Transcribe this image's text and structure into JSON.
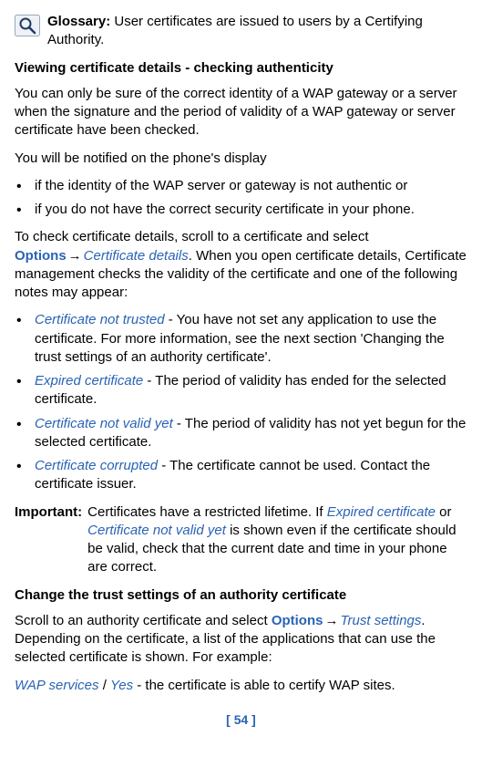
{
  "glossary": {
    "label": "Glossary:",
    "text": "User certificates are issued to users by a Certifying Authority."
  },
  "section1": {
    "heading": "Viewing certificate details - checking authenticity",
    "para1": "You can only be sure of the correct identity of a WAP gateway or a server when the signature and the period of validity of a WAP gateway or server certificate have been checked.",
    "para2": "You will be notified on the phone's display",
    "bullets": [
      "if the identity of the WAP server or gateway is not authentic or",
      "if you do not have the correct security certificate in your phone."
    ],
    "para3a": "To check certificate details, scroll to a certificate and select ",
    "options": "Options",
    "arrow": "→",
    "para3b": "Certificate details",
    "para3c": ". When you open certificate details, Certificate management checks the validity of the certificate and one of the following notes may appear:",
    "notes": [
      {
        "term": "Certificate not trusted",
        "text": " - You have not set any application to use the certificate. For more information, see the next section 'Changing the trust settings of an authority certificate'."
      },
      {
        "term": "Expired certificate",
        "text": " - The period of validity has ended for the selected certificate."
      },
      {
        "term": "Certificate not valid yet",
        "text": " - The period of validity has not yet begun for the selected certificate."
      },
      {
        "term": "Certificate corrupted",
        "text": " - The certificate cannot be used. Contact the certificate issuer."
      }
    ]
  },
  "important": {
    "label": "Important:",
    "pre": " Certificates have a restricted lifetime. If ",
    "term1": "Expired certificate",
    "mid": " or ",
    "term2": "Certificate not valid yet",
    "post": " is shown even if the certificate should be valid, check that the current date and time in your phone are correct."
  },
  "section2": {
    "heading": "Change the trust settings of an authority certificate",
    "para1a": "Scroll to an authority certificate and select ",
    "options": "Options",
    "arrow": "→",
    "para1b": "Trust settings",
    "para1c": ". Depending on the certificate, a list of the applications that can use the selected certificate is shown. For example:",
    "example_term": "WAP services",
    "example_sep": " / ",
    "example_val": "Yes",
    "example_text": " - the certificate is able to certify WAP sites."
  },
  "footer": "[ 54 ]"
}
